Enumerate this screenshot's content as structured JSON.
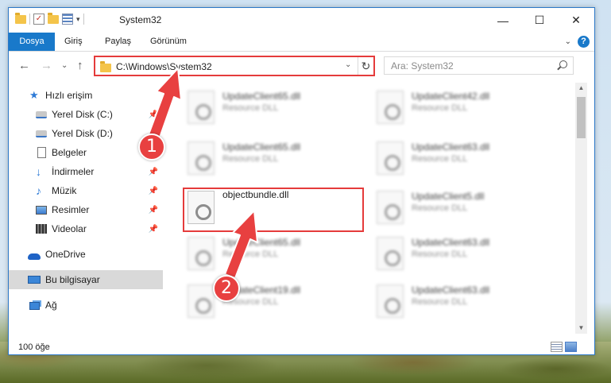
{
  "window": {
    "title": "System32",
    "controls": {
      "minimize": "—",
      "maximize": "☐",
      "close": "✕"
    }
  },
  "quick_access_toolbar": {
    "dropdown": "▾"
  },
  "ribbon": {
    "tabs": [
      {
        "label": "Dosya",
        "active": true
      },
      {
        "label": "Giriş"
      },
      {
        "label": "Paylaş"
      },
      {
        "label": "Görünüm"
      }
    ],
    "expand": "⌄",
    "help": "?"
  },
  "navigation": {
    "back": "←",
    "forward": "→",
    "recent": "⌄",
    "up": "↑"
  },
  "address_bar": {
    "path": "C:\\Windows\\System32",
    "dropdown": "⌄",
    "refresh": "↻"
  },
  "search": {
    "placeholder": "Ara: System32"
  },
  "sidebar": {
    "items": [
      {
        "label": "Hızlı erişim",
        "icon": "star-icon"
      },
      {
        "label": "Yerel Disk (C:)",
        "icon": "drive-icon",
        "pinned": true
      },
      {
        "label": "Yerel Disk (D:)",
        "icon": "drive-icon",
        "pinned": true
      },
      {
        "label": "Belgeler",
        "icon": "documents-icon",
        "pinned": true
      },
      {
        "label": "İndirmeler",
        "icon": "downloads-icon",
        "pinned": true
      },
      {
        "label": "Müzik",
        "icon": "music-icon",
        "pinned": true
      },
      {
        "label": "Resimler",
        "icon": "pictures-icon",
        "pinned": true
      },
      {
        "label": "Videolar",
        "icon": "videos-icon",
        "pinned": true
      },
      {
        "label": "OneDrive",
        "icon": "onedrive-icon"
      },
      {
        "label": "Bu bilgisayar",
        "icon": "this-pc-icon",
        "selected": true
      },
      {
        "label": "Ağ",
        "icon": "network-icon"
      }
    ],
    "pin_glyph": "📌"
  },
  "files": {
    "left_column": [
      {
        "name": "UpdateClient65.dll",
        "type": "Resource DLL"
      },
      {
        "name": "UpdateClient65.dll",
        "type": "Resource DLL"
      },
      {
        "name": "objectbundle.dll",
        "type": ""
      },
      {
        "name": "UpdateClient65.dll",
        "type": "Resource DLL"
      },
      {
        "name": "UpdateClient19.dll",
        "type": "Resource DLL"
      }
    ],
    "right_column": [
      {
        "name": "UpdateClient42.dll",
        "type": "Resource DLL"
      },
      {
        "name": "UpdateClient63.dll",
        "type": "Resource DLL"
      },
      {
        "name": "UpdateClient5.dll",
        "type": "Resource DLL"
      },
      {
        "name": "UpdateClient63.dll",
        "type": "Resource DLL"
      },
      {
        "name": "UpdateClient63.dll",
        "type": "Resource DLL"
      }
    ]
  },
  "scrollbar": {
    "up": "▲",
    "down": "▼"
  },
  "status_bar": {
    "item_count": "100 öğe"
  },
  "annotations": {
    "callouts": [
      "1",
      "2"
    ],
    "color": "#e84040"
  }
}
